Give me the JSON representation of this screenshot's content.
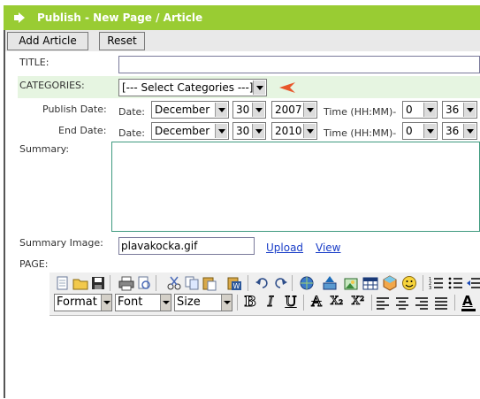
{
  "window": {
    "title": "Publish - New Page / Article"
  },
  "actions": {
    "add_article": "Add Article",
    "reset": "Reset"
  },
  "form": {
    "title_label": "TITLE:",
    "title_value": "",
    "categories_label": "CATEGORIES:",
    "categories_selected": "[--- Select Categories ---]",
    "publish_date": {
      "label": "Publish Date:",
      "date_label": "Date:",
      "month": "December",
      "day": "30",
      "year": "2007",
      "time_label": "Time (HH:MM)-",
      "hour": "0",
      "minute": "36"
    },
    "end_date": {
      "label": "End Date:",
      "date_label": "Date:",
      "month": "December",
      "day": "30",
      "year": "2010",
      "time_label": "Time (HH:MM)-",
      "hour": "0",
      "minute": "36"
    },
    "summary_label": "Summary:",
    "summary_value": "",
    "summary_image_label": "Summary Image:",
    "summary_image_value": "plavakocka.gif",
    "upload_link": "Upload",
    "view_link": "View",
    "page_label": "PAGE:"
  },
  "editor": {
    "format_label": "Format",
    "font_label": "Font",
    "size_label": "Size",
    "bold": "B",
    "italic": "I",
    "underline": "U",
    "strike": "A",
    "subscript": "X₂",
    "superscript": "X²",
    "text_color": "A"
  },
  "colors": {
    "title_bar": "#99cc33",
    "categories_bg": "#e6f5e1",
    "summary_border": "#3f9a7f",
    "link": "#1a3ec8",
    "pointer_arrow": "#e8562a"
  }
}
